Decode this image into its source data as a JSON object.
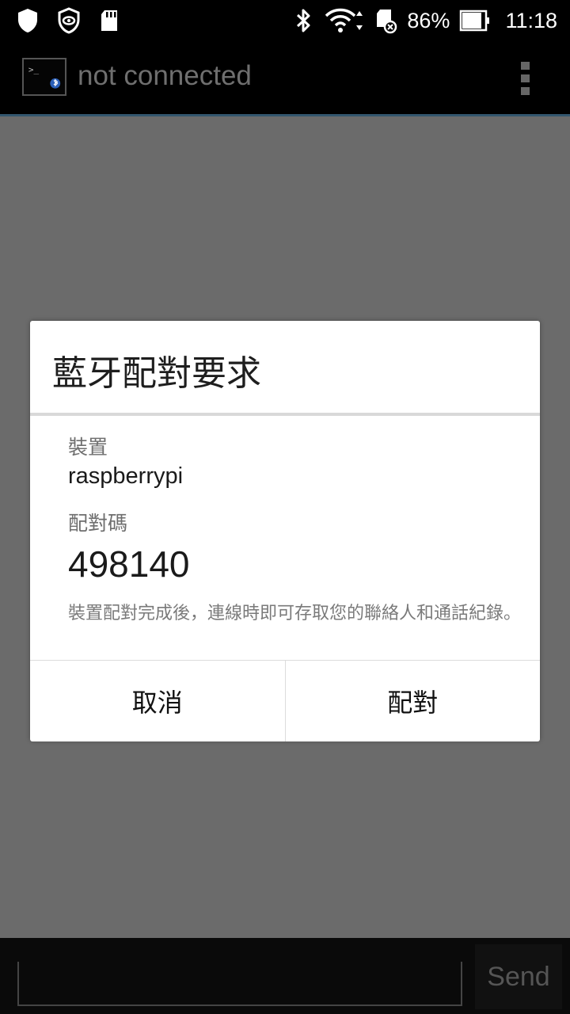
{
  "status_bar": {
    "icons_left": [
      "shield-icon",
      "eye-shield-icon",
      "sd-card-icon"
    ],
    "icons_right": [
      "bluetooth-icon",
      "wifi-icon",
      "sd-card-error-icon",
      "battery-icon"
    ],
    "battery_percent": "86%",
    "time": "11:18"
  },
  "action_bar": {
    "title": "not connected",
    "app_icon": "terminal-bluetooth-icon",
    "menu_icon": "overflow-menu-icon"
  },
  "dialog": {
    "title": "藍牙配對要求",
    "device_label": "裝置",
    "device_name": "raspberrypi",
    "pin_label": "配對碼",
    "pin_code": "498140",
    "note": "裝置配對完成後，連線時即可存取您的聯絡人和通話紀錄。",
    "cancel_label": "取消",
    "pair_label": "配對"
  },
  "bottom_bar": {
    "input_value": "",
    "send_label": "Send"
  },
  "colors": {
    "overlay": "#6b6b6b",
    "action_bar_accent": "#33566e",
    "dialog_bg": "#ffffff"
  }
}
